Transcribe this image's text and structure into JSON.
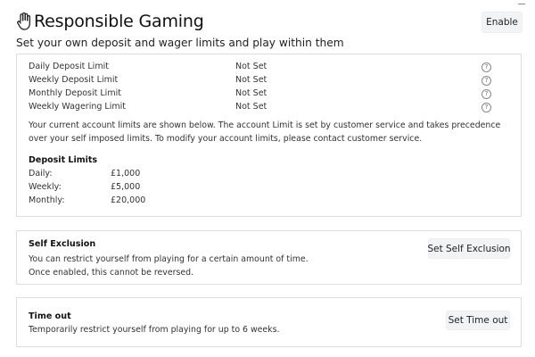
{
  "header": {
    "title": "Responsible Gaming",
    "enable_label": "Enable"
  },
  "subtitle": "Set your own deposit and wager limits and play within them",
  "limits": {
    "rows": [
      {
        "label": "Daily Deposit Limit",
        "value": "Not Set",
        "icon": "help-icon"
      },
      {
        "label": "Weekly Deposit Limit",
        "value": "Not Set",
        "icon": "help-icon"
      },
      {
        "label": "Monthly Deposit Limit",
        "value": "Not Set",
        "icon": "help-icon"
      },
      {
        "label": "Weekly Wagering Limit",
        "value": "Not Set",
        "icon": "help-icon"
      }
    ],
    "help_glyph": "?",
    "info": "Your current account limits are shown below. The account Limit is set by customer service and takes precedence over your self imposed limits. To modify your account limits, please contact customer service.",
    "deposit_heading": "Deposit Limits",
    "deposit_rows": [
      {
        "label": "Daily:",
        "value": "£1,000"
      },
      {
        "label": "Weekly:",
        "value": "£5,000"
      },
      {
        "label": "Monthly:",
        "value": "£20,000"
      }
    ]
  },
  "self_exclusion": {
    "title": "Self Exclusion",
    "description": "You can restrict yourself from playing for a certain amount of time. Once enabled, this cannot be reversed.",
    "button_label": "Set Self Exclusion"
  },
  "time_out": {
    "title": "Time out",
    "description": "Temporarily restrict yourself from playing for up to 6 weeks.",
    "button_label": "Set Time out"
  },
  "colors": {
    "button_bg": "#f2f3f5",
    "border": "#dadde1",
    "text": "#222222"
  }
}
